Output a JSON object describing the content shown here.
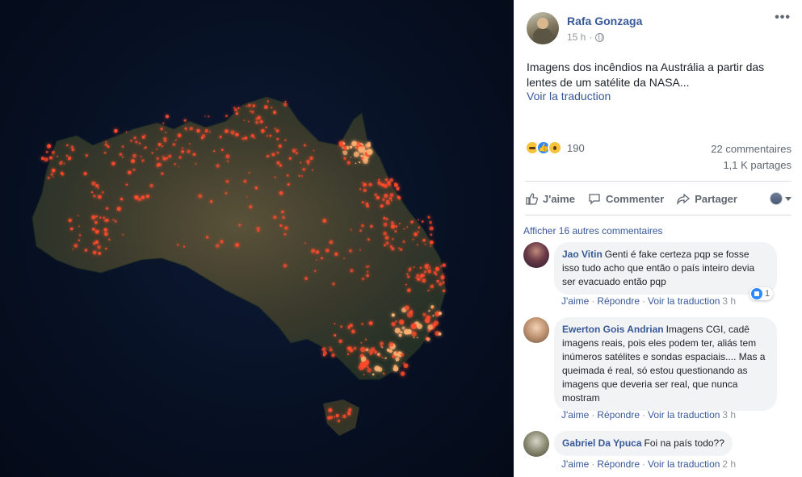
{
  "photo": {
    "alt_icon": "satellite-fire-map-image",
    "colors": {
      "ocean": "#071022",
      "land": "#3b3a2c",
      "fire": "#ff4a2a",
      "fire_glow": "#ffb070"
    }
  },
  "post": {
    "author": "Rafa Gonzaga",
    "time": "15 h",
    "more_icon": "•••",
    "text": "Imagens dos incêndios na Austrália a partir das lentes de um satélite da NASA...",
    "translate_link": "Voir la traduction",
    "reaction_count": "190",
    "comments_count": "22 commentaires",
    "shares_count": "1,1 K partages",
    "actions": {
      "like": "J'aime",
      "comment": "Commenter",
      "share": "Partager"
    }
  },
  "comments_section": {
    "more_comments": "Afficher 16 autres commentaires",
    "comments": [
      {
        "name": "Jao Vitin",
        "text": "Genti é fake certeza pqp se fosse isso tudo acho que então o país inteiro devia ser evacuado então pqp",
        "like": "J'aime",
        "reply": "Répondre",
        "translate": "Voir la traduction",
        "time": "3 h",
        "reactions": "1"
      },
      {
        "name": "Ewerton Gois Andrian",
        "text": "Imagens CGI, cadê imagens reais, pois eles podem ter, aliás tem inúmeros satélites e sondas espaciais.... Mas a queimada é real, só estou questionando as imagens que deveria ser real, que nunca mostram",
        "like": "J'aime",
        "reply": "Répondre",
        "translate": "Voir la traduction",
        "time": "3 h"
      },
      {
        "name": "Gabriel Da Ypuca",
        "text": "Foi na país todo??",
        "like": "J'aime",
        "reply": "Répondre",
        "translate": "Voir la traduction",
        "time": "2 h"
      }
    ]
  }
}
